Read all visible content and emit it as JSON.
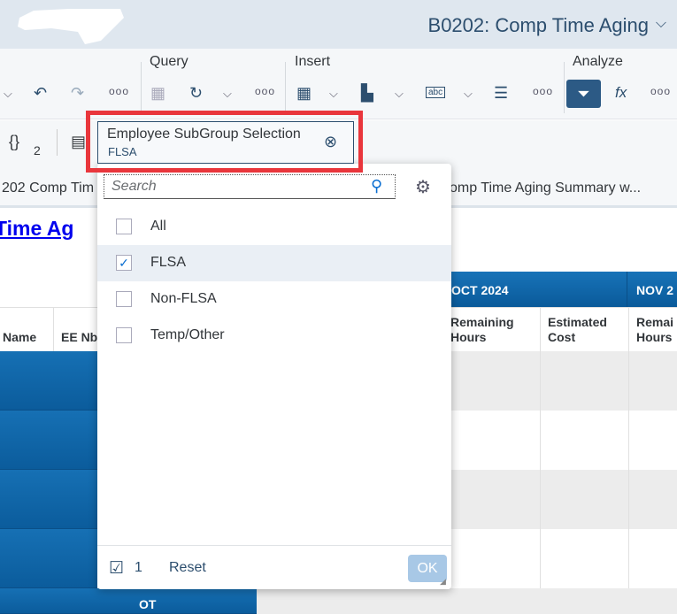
{
  "header": {
    "title": "B0202: Comp Time Aging"
  },
  "toolbar": {
    "groups": [
      "Query",
      "Insert",
      "Analyze"
    ],
    "fx_label": "fx"
  },
  "row2": {
    "variables_label": "{}",
    "variables_count": "2"
  },
  "tabs": [
    "202 Comp Tim",
    "omp Time Aging Summary w..."
  ],
  "report": {
    "title": "Time Ag"
  },
  "table": {
    "months": [
      "OCT 2024",
      "NOV 2"
    ],
    "columns": [
      "Name",
      "EE Nb",
      "Remaining Hours",
      "Estimated Cost",
      "Remai Hours"
    ],
    "bottom_cell": "OT"
  },
  "filter_token": {
    "title": "Employee SubGroup Selection",
    "value": "FLSA"
  },
  "popup": {
    "search_placeholder": "Search",
    "items": [
      {
        "label": "All",
        "checked": false
      },
      {
        "label": "FLSA",
        "checked": true
      },
      {
        "label": "Non-FLSA",
        "checked": false
      },
      {
        "label": "Temp/Other",
        "checked": false
      }
    ],
    "selected_count": "1",
    "reset_label": "Reset",
    "ok_label": "OK"
  },
  "colors": {
    "accent": "#0a6ed1",
    "header_blue": "#0b5c9c",
    "highlight": "#e9363c"
  }
}
